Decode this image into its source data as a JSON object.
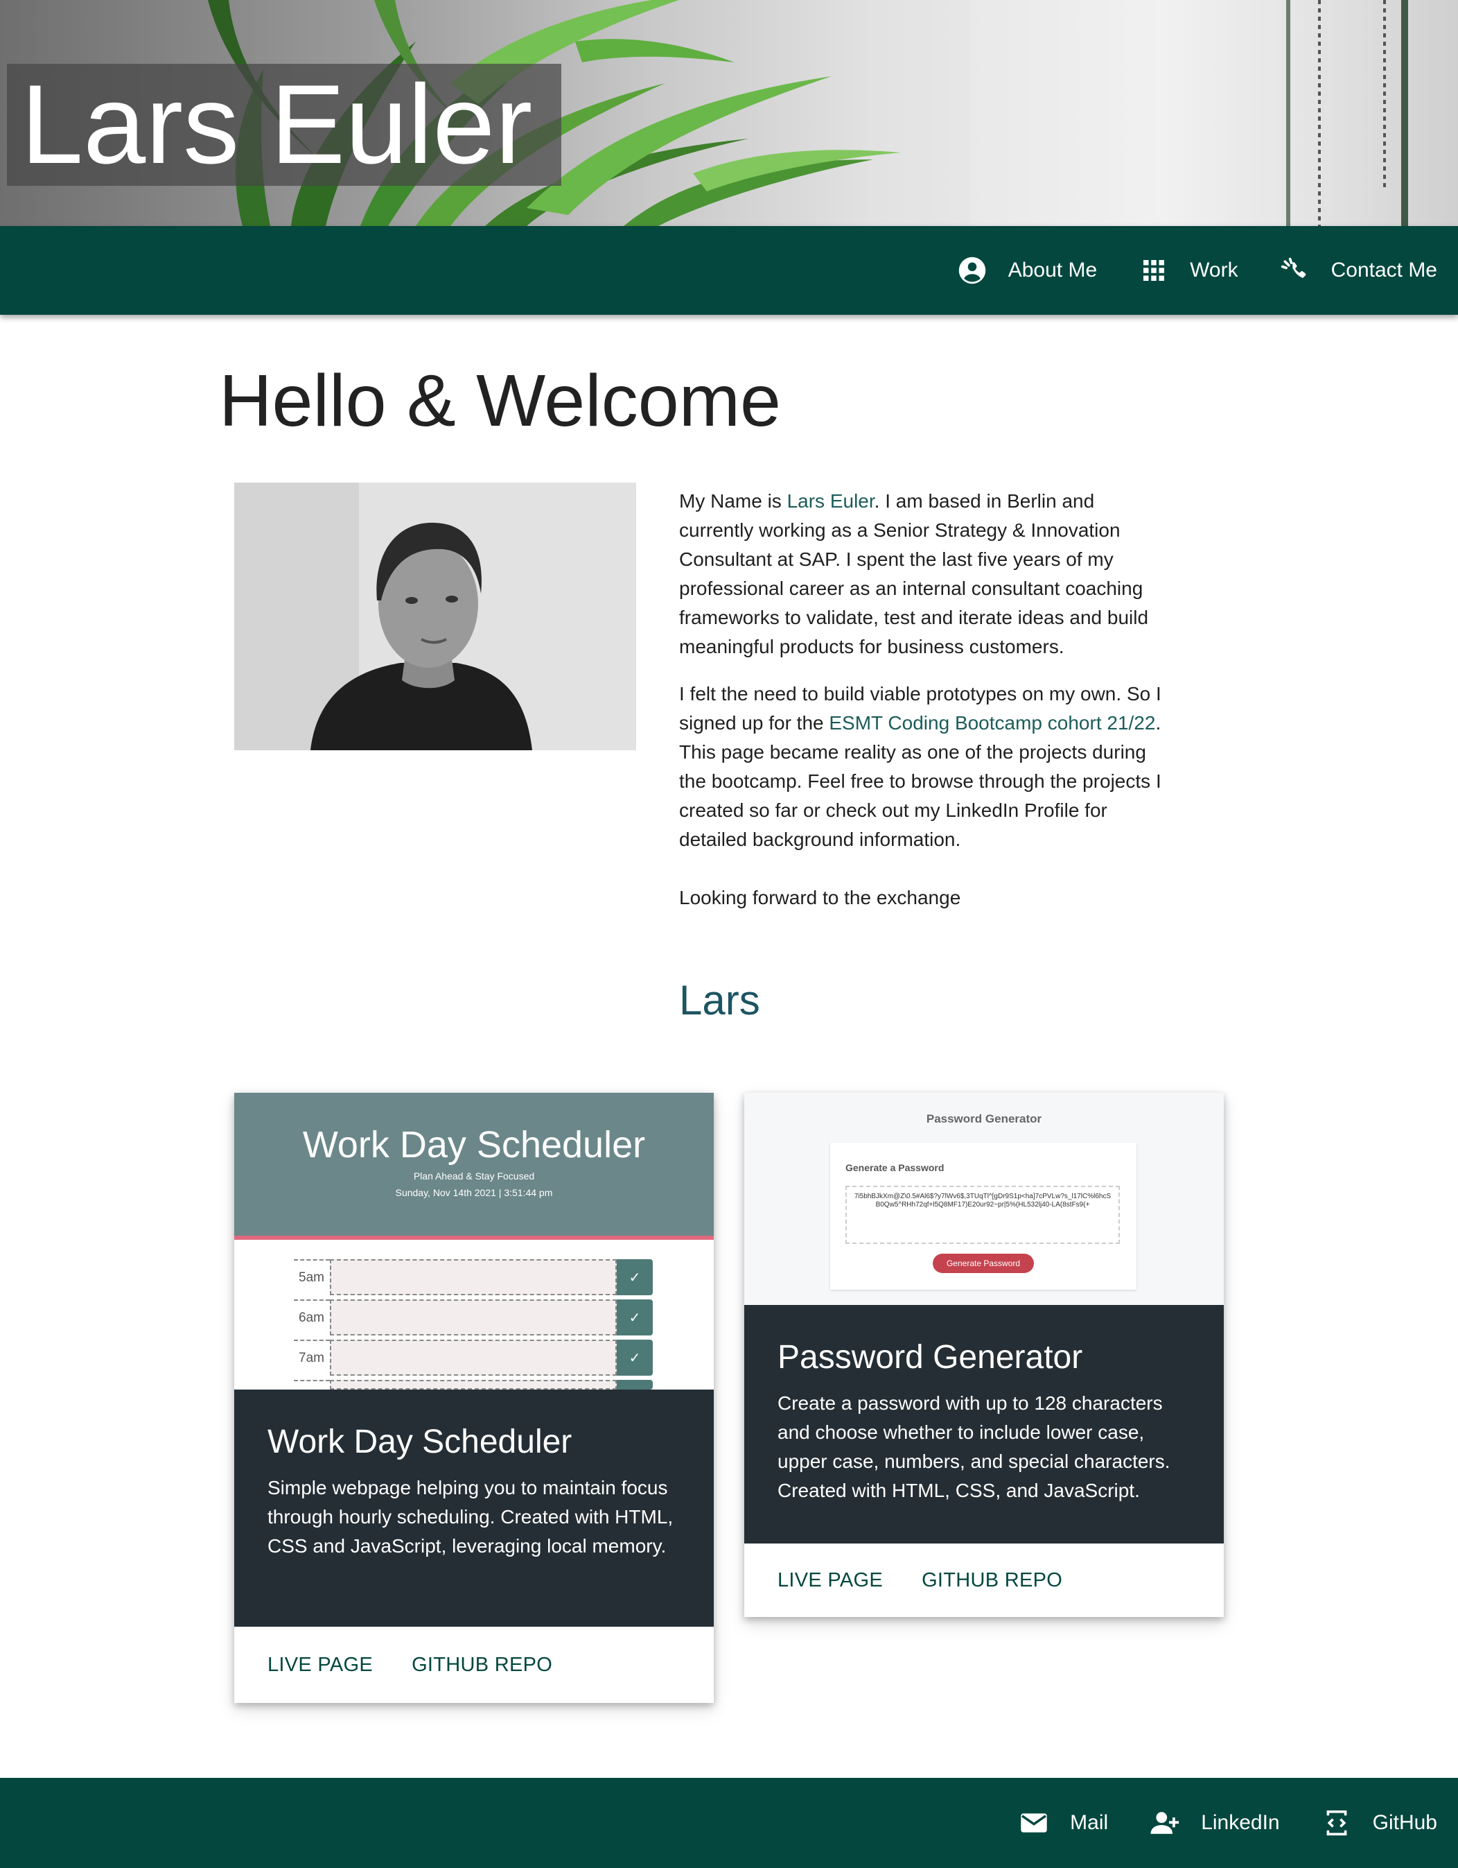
{
  "header": {
    "name": "Lars Euler"
  },
  "nav": {
    "items": [
      {
        "label": "About Me",
        "icon": "account-circle-icon"
      },
      {
        "label": "Work",
        "icon": "apps-grid-icon"
      },
      {
        "label": "Contact Me",
        "icon": "contact-phone-icon"
      }
    ]
  },
  "main": {
    "title": "Hello & Welcome",
    "about": {
      "p1_before": "My Name is ",
      "p1_name": "Lars Euler",
      "p1_after": ". I am based in Berlin and currently working as a Senior Strategy & Innovation Consultant at SAP. I spent the last five years of my professional career as an internal consultant coaching frameworks to validate, test and iterate ideas and build meaningful products for business customers.",
      "p2_before": "I felt the need to build viable prototypes on my own. So I signed up for the ",
      "p2_link": "ESMT Coding Bootcamp cohort 21/22",
      "p2_after": ". This page became reality as one of the projects during the bootcamp. Feel free to browse through the projects I created so far or check out my LinkedIn Profile for detailed background information.",
      "p3": "Looking forward to the exchange",
      "signature": "Lars"
    }
  },
  "projects": [
    {
      "title": "Work Day Scheduler",
      "description": "Simple webpage helping you to maintain focus through hourly scheduling. Created with HTML, CSS and JavaScript, leveraging local memory.",
      "live_label": "Live Page",
      "repo_label": "GitHub Repo",
      "preview": {
        "title": "Work Day Scheduler",
        "subtitle": "Plan Ahead & Stay Focused",
        "date": "Sunday, Nov 14th 2021 | 3:51:44 pm",
        "hours": [
          "5am",
          "6am",
          "7am"
        ],
        "save_glyph": "✓"
      }
    },
    {
      "title": "Password Generator",
      "description": "Create a password with up to 128 characters and choose whether to include lower case, upper case, numbers, and special characters. Created with HTML, CSS, and JavaScript.",
      "live_label": "Live Page",
      "repo_label": "GitHub Repo",
      "preview": {
        "title": "Password Generator",
        "label": "Generate a Password",
        "password": "7i5bhBJkXm@Z\\0.5#Al6$?y7lWv6$,3TUqTl^[gDr9S1p<ha]7cPVLw?s_l17lC%l6hcSB0Qw5^RHh72qf+l5Q8MF17)E20ur92~pr|5%(HL532lj40-LA(8stFs9(+",
        "button": "Generate Password"
      }
    }
  ],
  "footer": {
    "items": [
      {
        "label": "Mail",
        "icon": "mail-icon"
      },
      {
        "label": "LinkedIn",
        "icon": "person-add-icon"
      },
      {
        "label": "GitHub",
        "icon": "code-device-icon"
      }
    ]
  }
}
